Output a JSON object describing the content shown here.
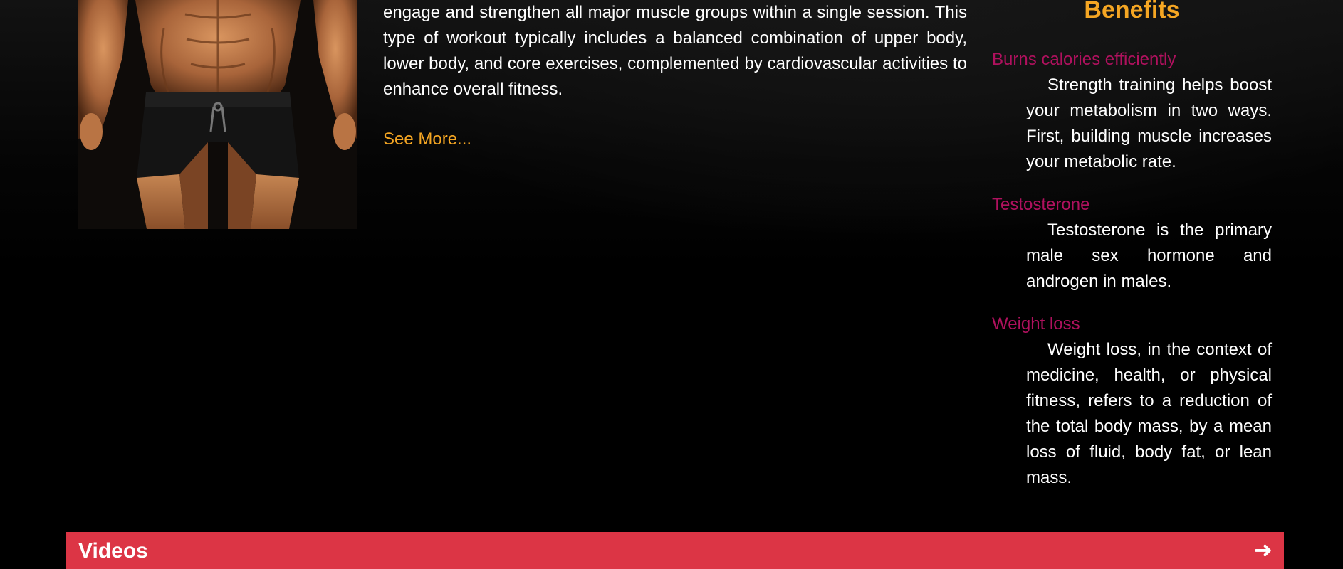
{
  "intro": {
    "text": "engage and strengthen all major muscle groups within a single session. This type of workout typically includes a balanced combination of upper body, lower body, and core exercises, complemented by cardiovascular activities to enhance overall fitness.",
    "see_more_label": "See More..."
  },
  "hero_image": {
    "icon": "muscular-torso-photo"
  },
  "benefits": {
    "title": "Benefits",
    "items": [
      {
        "heading": "Burns calories efficiently",
        "text": "Strength training helps boost your metabolism in two ways. First, building muscle increases your metabolic rate."
      },
      {
        "heading": "Testosterone",
        "text": "Testosterone is the primary male sex hormone and androgen in males."
      },
      {
        "heading": "Weight loss",
        "text": "Weight loss, in the context of medicine, health, or physical fitness, refers to a reduction of the total body mass, by a mean loss of fluid, body fat, or lean mass."
      }
    ]
  },
  "videos": {
    "label": "Videos",
    "arrow": "➜"
  },
  "colors": {
    "accent_orange": "#f5a623",
    "benefit_heading": "#b0115e",
    "videos_bar": "#dc3545",
    "background": "#000000"
  }
}
